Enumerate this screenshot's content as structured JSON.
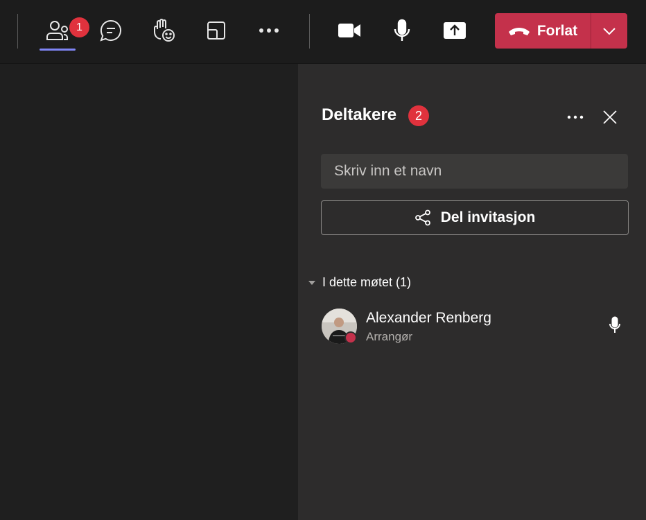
{
  "toolbar": {
    "participants_badge": "1",
    "leave_label": "Forlat"
  },
  "panel": {
    "title": "Deltakere",
    "title_badge": "2",
    "search_placeholder": "Skriv inn et navn",
    "share_label": "Del invitasjon",
    "section_label": "I dette møtet (1)",
    "participants": [
      {
        "name": "Alexander Renberg",
        "role": "Arrangør"
      }
    ]
  },
  "colors": {
    "leave": "#c4314b",
    "badge": "#e0323d",
    "active_underline": "#7f85f5",
    "panel_bg": "#2d2c2c"
  }
}
